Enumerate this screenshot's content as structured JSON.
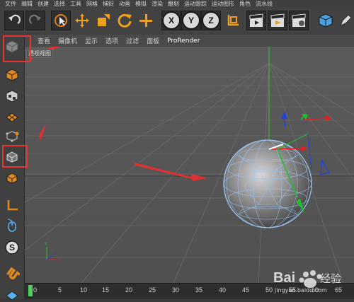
{
  "menubar": [
    "文件",
    "编辑",
    "创建",
    "选择",
    "工具",
    "网格",
    "捕捉",
    "动画",
    "模拟",
    "渲染",
    "雕刻",
    "运动跟踪",
    "运动图形",
    "角色",
    "流水线"
  ],
  "toolbar": {
    "undo": "undo-icon",
    "redo": "redo-icon",
    "axis_x": "X",
    "axis_y": "Y",
    "axis_z": "Z"
  },
  "viewport": {
    "menu": [
      "查看",
      "摄像机",
      "显示",
      "选项",
      "过滤",
      "面板",
      "ProRender"
    ],
    "label": "透视视图"
  },
  "timeline": {
    "ticks": [
      "0",
      "5",
      "10",
      "15",
      "20",
      "25",
      "30",
      "35",
      "40",
      "45",
      "50",
      "55",
      "60",
      "65"
    ]
  },
  "watermark": {
    "brand": "Bai",
    "brand2": "经验",
    "url": "jingyan.baidu.com"
  },
  "colors": {
    "highlight": "#e03030",
    "axis_x": "#e02020",
    "axis_y": "#20c030",
    "axis_z": "#2040e0",
    "sphere_wire": "#8fb8e8"
  }
}
